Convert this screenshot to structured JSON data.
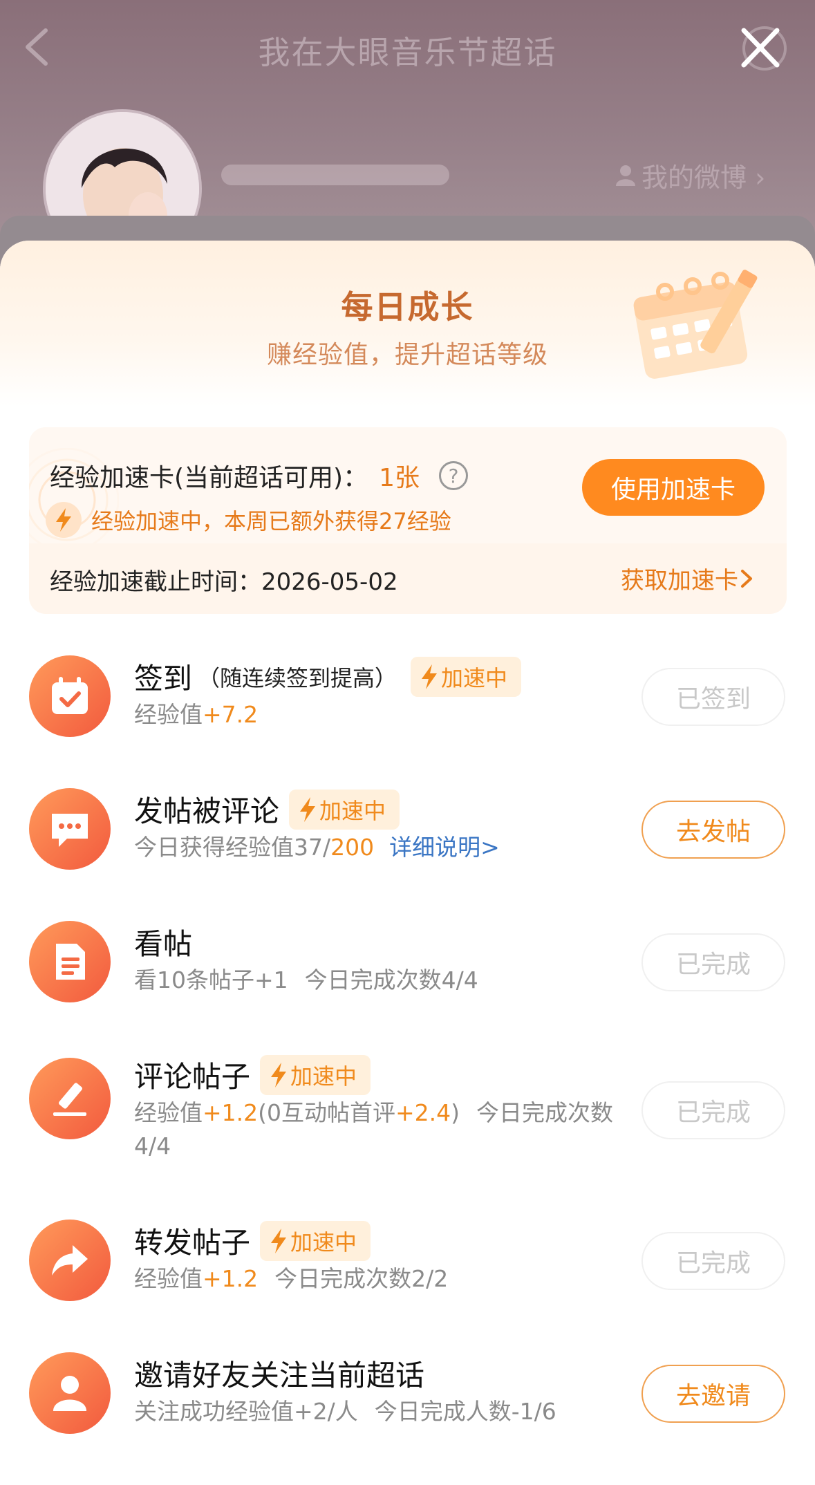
{
  "header": {
    "title": "我在大眼音乐节超话",
    "my_weibo": "我的微博 ›"
  },
  "sheet": {
    "title": "每日成长",
    "subtitle": "赚经验值，提升超话等级"
  },
  "boost_card": {
    "label": "经验加速卡(当前超话可用)：",
    "count": "1张",
    "help": "?",
    "status": "经验加速中，本周已额外获得27经验",
    "use_button": "使用加速卡",
    "deadline_label": "经验加速截止时间：",
    "deadline_value": "2026-05-02",
    "get_card_link": "获取加速卡"
  },
  "boost_badge": "加速中",
  "tasks": [
    {
      "title": "签到",
      "note": "（随连续签到提高）",
      "desc_prefix": "经验值",
      "desc_value": "+7.2",
      "button": "已签到"
    },
    {
      "title": "发帖被评论",
      "desc_prefix": "今日获得经验值37/",
      "desc_value": "200",
      "desc_link": "详细说明>",
      "button": "去发帖"
    },
    {
      "title": "看帖",
      "desc": "看10条帖子+1",
      "desc_count": "今日完成次数4/4",
      "button": "已完成"
    },
    {
      "title": "评论帖子",
      "desc_prefix": "经验值",
      "desc_value": "+1.2",
      "desc_mid": "(0互动帖首评",
      "desc_value2": "+2.4",
      "desc_end": ")",
      "desc_count": "今日完成次数",
      "desc_line2": "4/4",
      "button": "已完成"
    },
    {
      "title": "转发帖子",
      "desc_prefix": "经验值",
      "desc_value": "+1.2",
      "desc_count": "今日完成次数2/2",
      "button": "已完成"
    },
    {
      "title": "邀请好友关注当前超话",
      "desc": "关注成功经验值+2/人",
      "desc_count": "今日完成人数-1/6",
      "button": "去邀请"
    }
  ],
  "colors": {
    "accent": "#ff8a1f",
    "title_brown": "#c6692f",
    "highlight": "#f08a1c",
    "link": "#3b76c4"
  }
}
